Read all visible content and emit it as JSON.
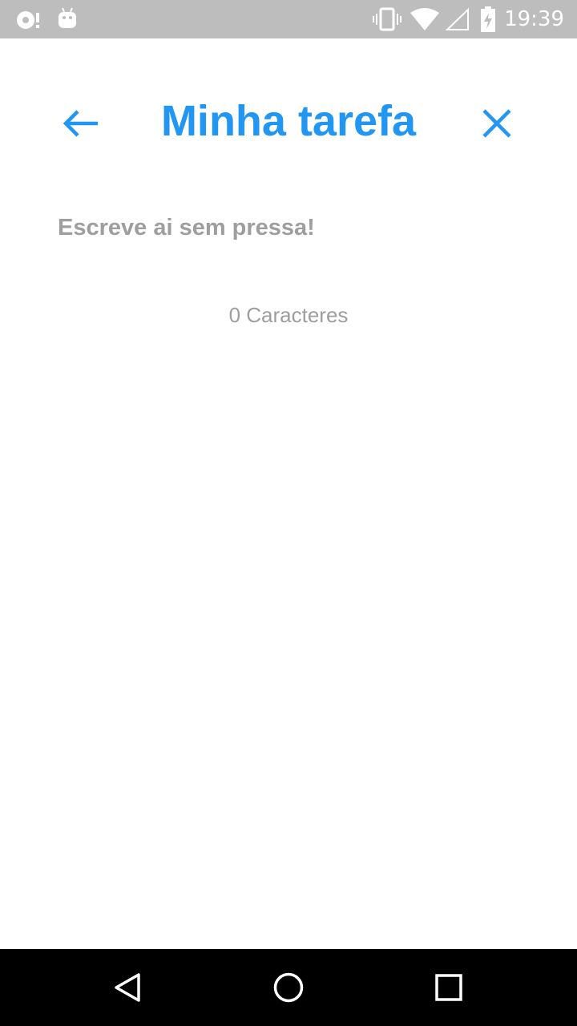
{
  "status_bar": {
    "time": "19:39",
    "icons": [
      "notification-icon",
      "android-icon",
      "vibrate-icon",
      "wifi-icon",
      "signal-icon",
      "battery-charging-icon"
    ]
  },
  "header": {
    "title": "Minha tarefa",
    "back_icon": "arrow-back-icon",
    "close_icon": "close-icon"
  },
  "task_input": {
    "value": "",
    "placeholder": "Escreve ai sem pressa!"
  },
  "char_count": {
    "text": "0 Caracteres"
  },
  "nav_bar": {
    "icons": [
      "back-triangle-icon",
      "home-circle-icon",
      "recents-square-icon"
    ]
  },
  "colors": {
    "accent": "#2196f3",
    "placeholder": "#9e9e9e",
    "status_bar": "#bdbdbd",
    "nav_bar": "#000000"
  }
}
